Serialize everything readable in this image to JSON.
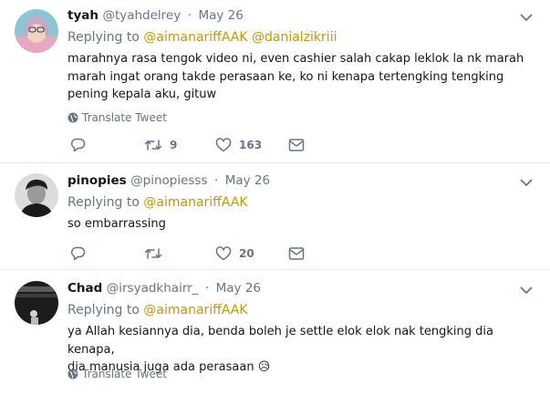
{
  "tweets": [
    {
      "name": "tyah",
      "handle": "@tyahdelrey",
      "dot": "·",
      "date": "May 26",
      "replying_prefix": "Replying to",
      "mentions": [
        "@aimanariffAAK",
        "@danialzikriii"
      ],
      "text": "marahnya rasa tengok video ni, even cashier salah cakap leklok la nk marah marah ingat orang takde perasaan ke, ko ni kenapa tertengking tengking pening kepala aku, gituw",
      "translate_label": "Translate Tweet",
      "reply_count": "",
      "retweet_count": "9",
      "like_count": "163"
    },
    {
      "name": "pinopies",
      "handle": "@pinopiesss",
      "dot": "·",
      "date": "May 26",
      "replying_prefix": "Replying to",
      "mentions": [
        "@aimanariffAAK"
      ],
      "text": "so embarrassing",
      "reply_count": "",
      "retweet_count": "",
      "like_count": "20"
    },
    {
      "name": "Chad",
      "handle": "@irsyadkhairr_",
      "dot": "·",
      "date": "May 26",
      "replying_prefix": "Replying to",
      "mentions": [
        "@aimanariffAAK"
      ],
      "text_line1": "ya Allah kesiannya dia, benda boleh je settle elok elok nak tengking dia kenapa,",
      "text_line2": "dia manusia juga ada perasaan",
      "emoji": "😥",
      "translate_label": "Translate Tweet"
    }
  ],
  "colors": {
    "mention": "#c5950e",
    "secondary_text": "#657786",
    "divider": "#e6ecf0"
  },
  "icons": [
    "chevron-down-icon",
    "reply-icon",
    "retweet-icon",
    "like-icon",
    "dm-icon",
    "globe-icon"
  ]
}
